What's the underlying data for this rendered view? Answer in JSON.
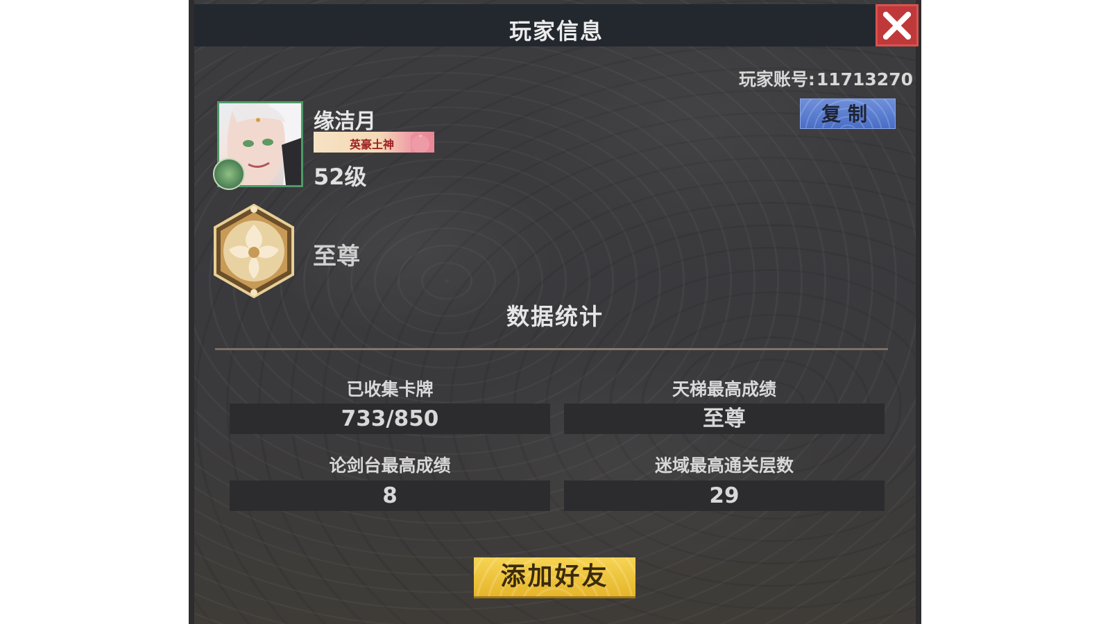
{
  "window": {
    "title": "玩家信息"
  },
  "icons": {
    "close": "close-icon",
    "avatar": "character-portrait",
    "rank": "rank-emblem-icon"
  },
  "account": {
    "label": "玩家账号:",
    "id": "11713270",
    "copy_label": "复制"
  },
  "player": {
    "name": "缘洁月",
    "title_tag": "英豪土神",
    "level": "52级",
    "rank": "至尊"
  },
  "stats": {
    "heading": "数据统计",
    "items": [
      {
        "label": "已收集卡牌",
        "value": "733/850"
      },
      {
        "label": "天梯最高成绩",
        "value": "至尊"
      },
      {
        "label": "论剑台最高成绩",
        "value": "8"
      },
      {
        "label": "迷域最高通关层数",
        "value": "29"
      }
    ]
  },
  "actions": {
    "add_friend": "添加好友"
  },
  "colors": {
    "close_bg": "#c0393a",
    "copy_bg": "#5a7ed0",
    "add_friend_bg": "#eec43c",
    "panel_bg": "#3b3b3e"
  }
}
